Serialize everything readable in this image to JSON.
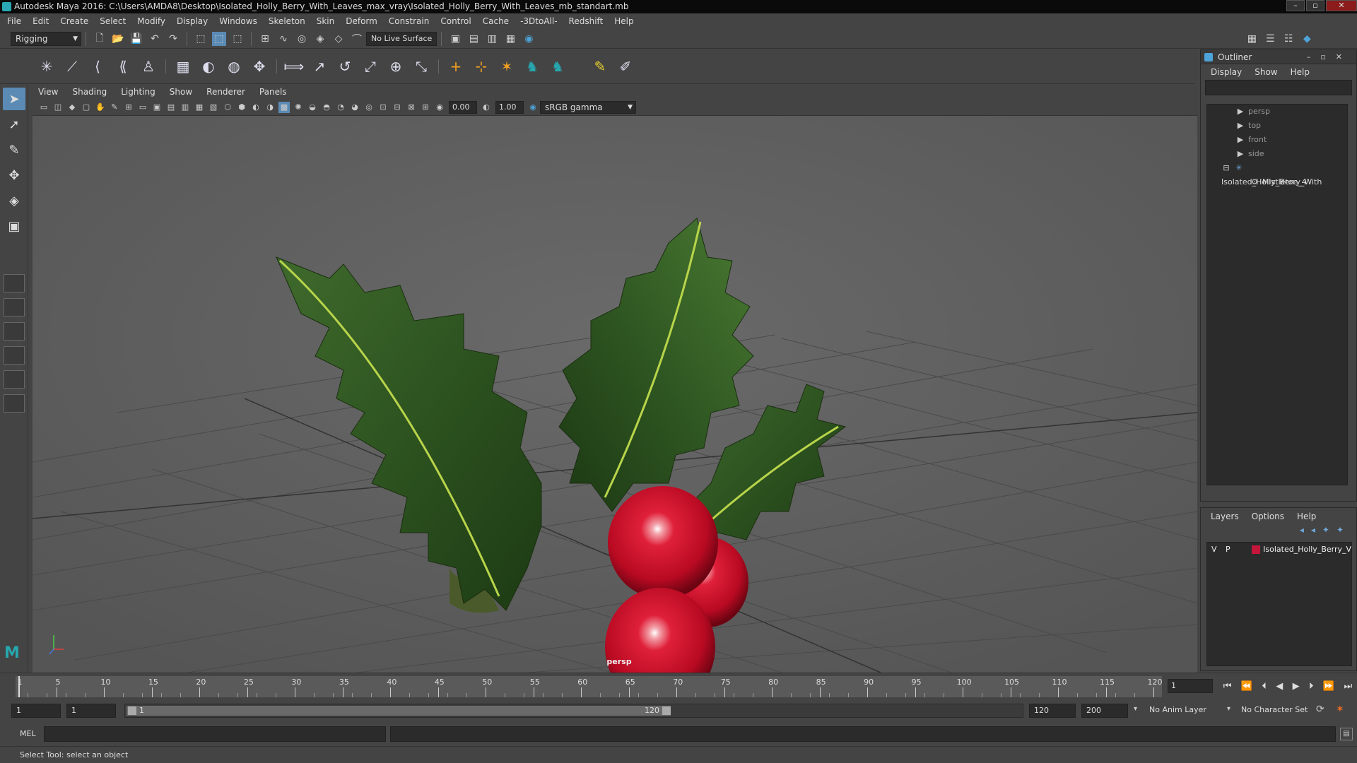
{
  "window": {
    "title": "Autodesk Maya 2016: C:\\Users\\AMDA8\\Desktop\\Isolated_Holly_Berry_With_Leaves_max_vray\\Isolated_Holly_Berry_With_Leaves_mb_standart.mb"
  },
  "menubar": {
    "items": [
      "File",
      "Edit",
      "Create",
      "Select",
      "Modify",
      "Display",
      "Windows",
      "Skeleton",
      "Skin",
      "Deform",
      "Constrain",
      "Control",
      "Cache",
      "-3DtoAll-",
      "Redshift",
      "Help"
    ]
  },
  "statusline": {
    "mode": "Rigging",
    "live_surface": "No Live Surface"
  },
  "viewport": {
    "menu": [
      "View",
      "Shading",
      "Lighting",
      "Show",
      "Renderer",
      "Panels"
    ],
    "exposure": "0.00",
    "gamma": "1.00",
    "color_space": "sRGB gamma",
    "camera_label": "persp"
  },
  "outliner": {
    "title": "Outliner",
    "menu": [
      "Display",
      "Show",
      "Help"
    ],
    "items": [
      {
        "label": "persp",
        "icon": "camera-icon",
        "level": 0
      },
      {
        "label": "top",
        "icon": "camera-icon",
        "level": 0
      },
      {
        "label": "front",
        "icon": "camera-icon",
        "level": 0
      },
      {
        "label": "side",
        "icon": "camera-icon",
        "level": 0
      },
      {
        "label": "Isolated_Holly_Berry_With",
        "icon": "group-icon",
        "level": 0
      },
      {
        "label": "Mistletoe_4",
        "icon": "mesh-icon",
        "level": 1
      }
    ]
  },
  "layers": {
    "menu": [
      "Layers",
      "Options",
      "Help"
    ],
    "rows": [
      {
        "v": "V",
        "p": "P",
        "name": "Isolated_Holly_Berry_V",
        "color": "#c4163a"
      }
    ]
  },
  "timeline": {
    "ticks": [
      1,
      5,
      10,
      15,
      20,
      25,
      30,
      35,
      40,
      45,
      50,
      55,
      60,
      65,
      70,
      75,
      80,
      85,
      90,
      95,
      100,
      105,
      110,
      115,
      120
    ],
    "current_frame": "1",
    "start": 1,
    "end": 120
  },
  "range": {
    "start": "1",
    "playback_start": "1",
    "slider_start": "1",
    "slider_end": "120",
    "playback_end": "120",
    "end": "200",
    "anim_layer": "No Anim Layer",
    "character_set": "No Character Set"
  },
  "cmdline": {
    "language": "MEL"
  },
  "helpline": {
    "text": "Select Tool: select an object"
  }
}
